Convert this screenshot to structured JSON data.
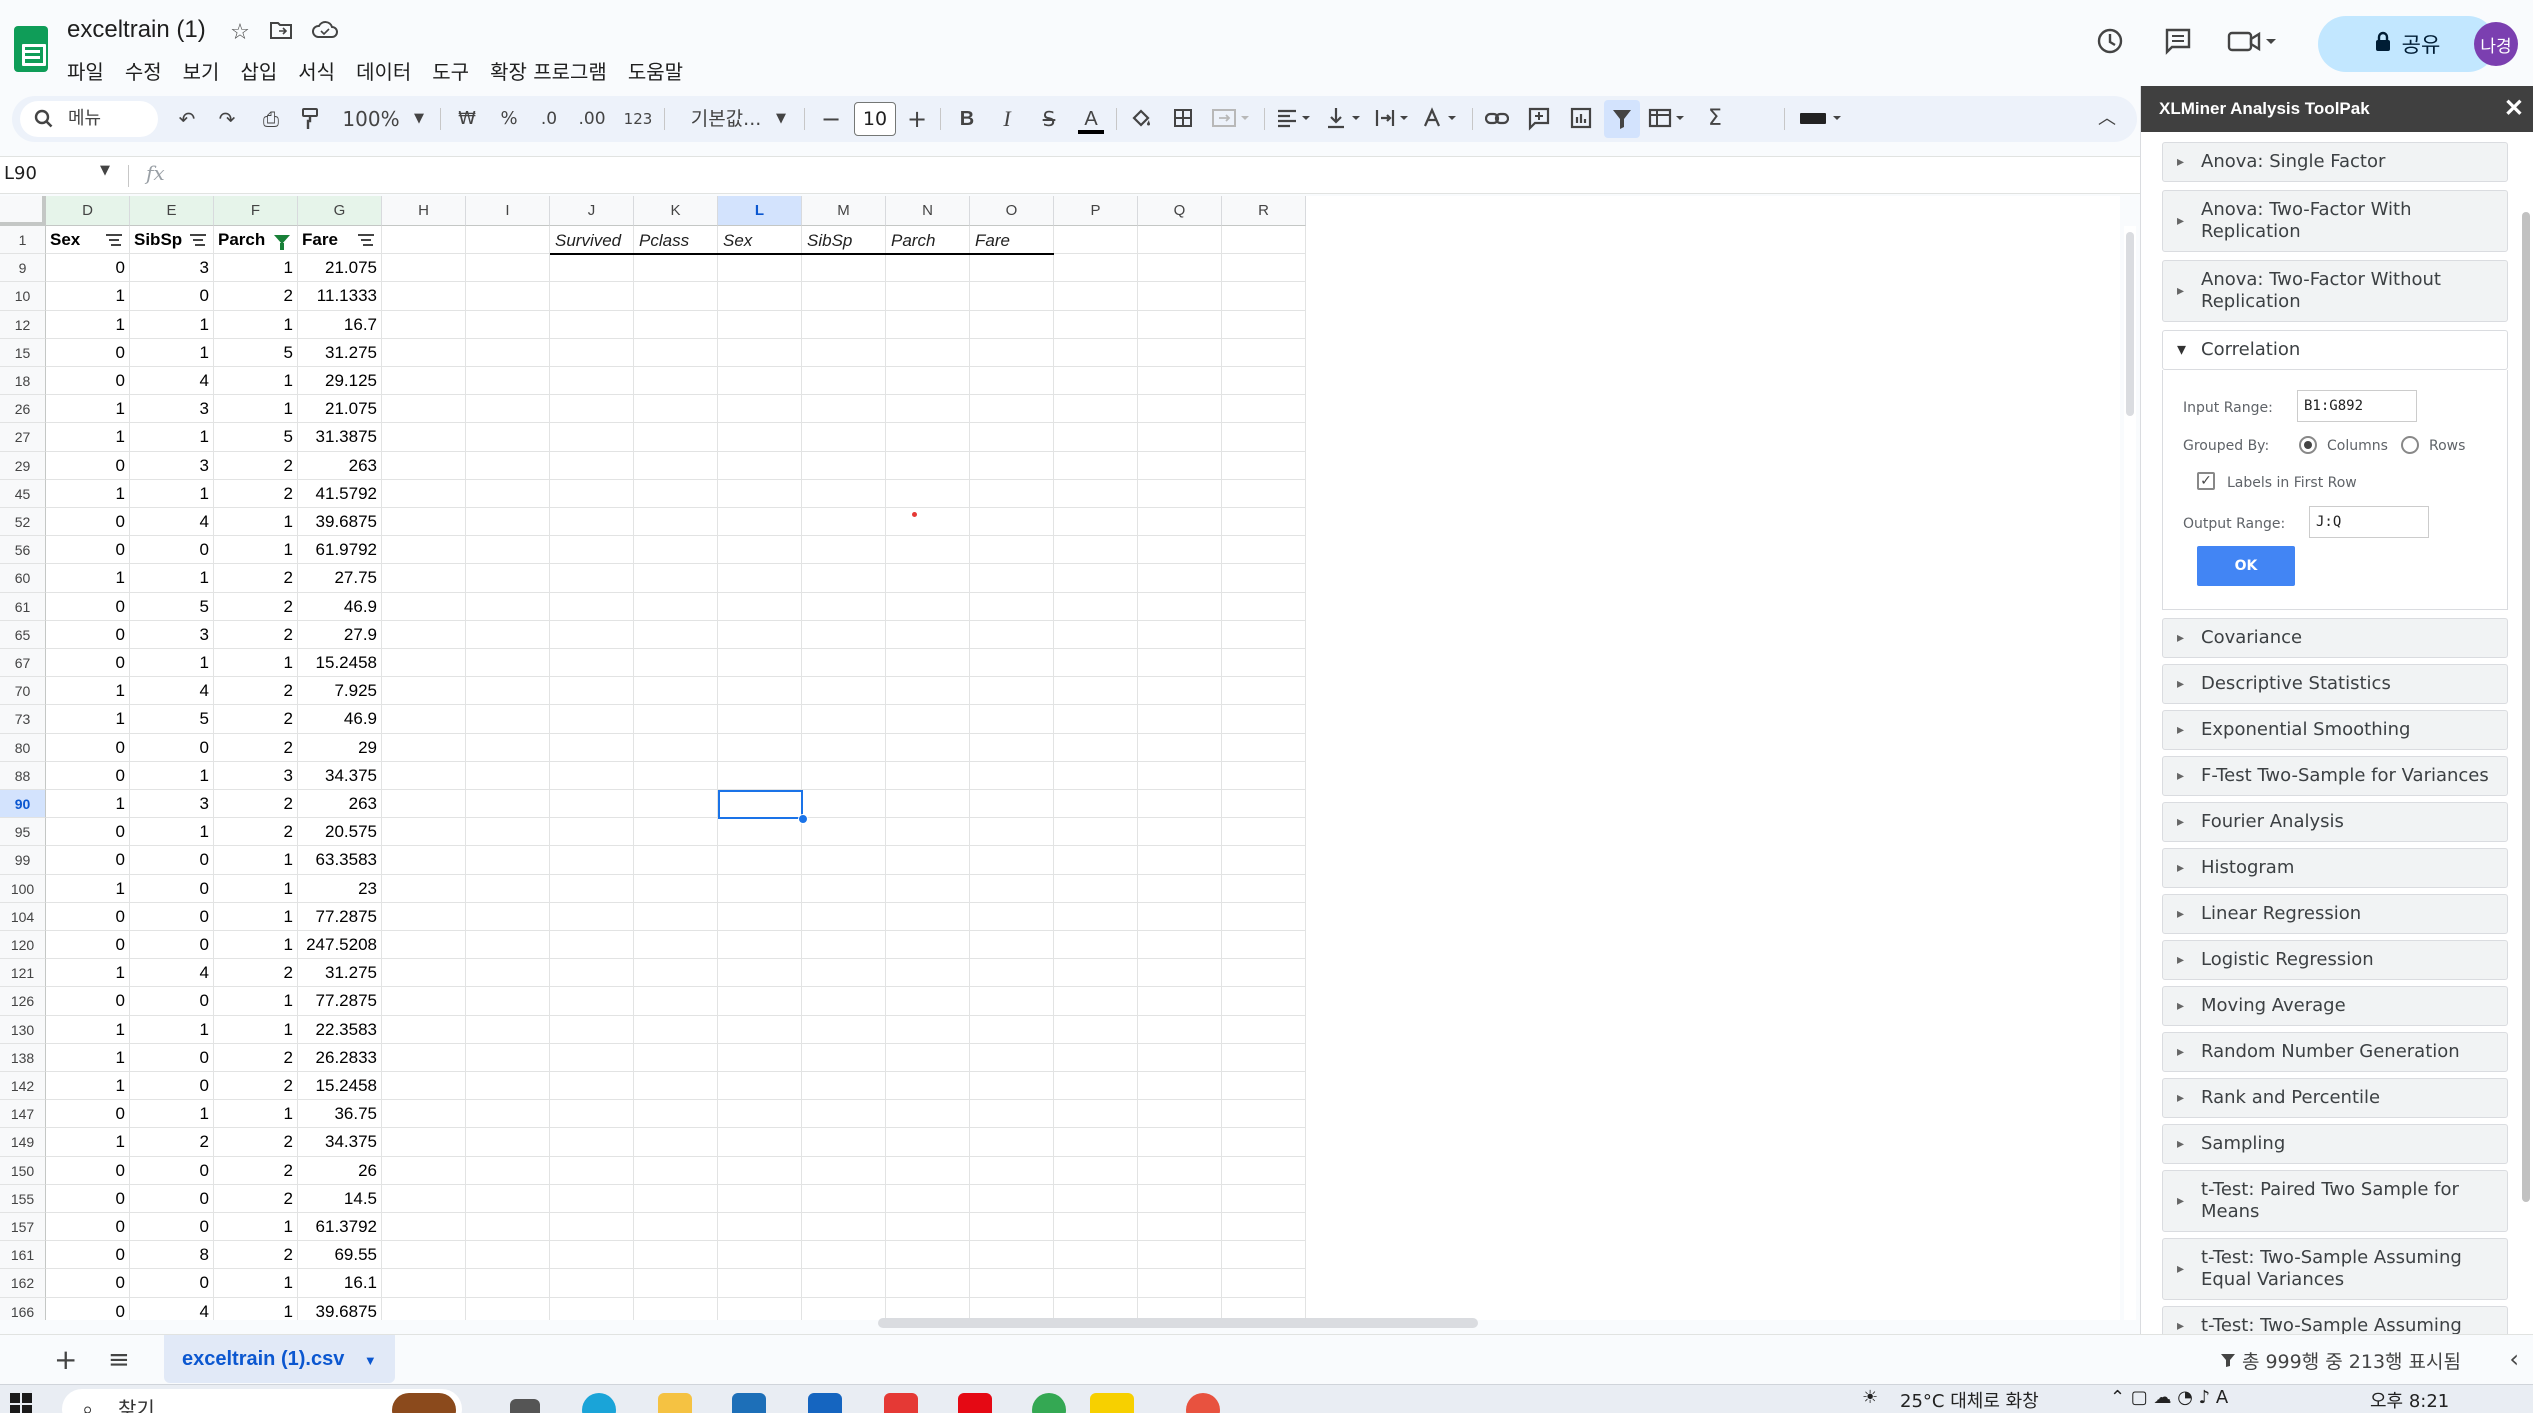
{
  "app": {
    "title": "exceltrain (1)",
    "menu": [
      "파일",
      "수정",
      "보기",
      "삽입",
      "서식",
      "데이터",
      "도구",
      "확장 프로그램",
      "도움말"
    ],
    "share_label": "공유",
    "avatar_initials": "나경"
  },
  "toolbar": {
    "search_label": "메뉴",
    "zoom": "100%",
    "currency": "₩",
    "percent": "%",
    "dec_decrease": ".0",
    "dec_increase": ".00",
    "number_format": "123",
    "font": "기본값...",
    "font_size": "10",
    "bold": "B",
    "italic": "I",
    "strike": "S",
    "text_color": "A"
  },
  "formula_bar": {
    "name_box": "L90",
    "fx": "fx"
  },
  "grid": {
    "columns": [
      "D",
      "E",
      "F",
      "G",
      "H",
      "I",
      "J",
      "K",
      "L",
      "M",
      "N",
      "O",
      "P",
      "Q",
      "R"
    ],
    "header_row_number": "1",
    "data_headers": [
      "Sex",
      "SibSp",
      "Parch",
      "Fare"
    ],
    "output_headers": [
      "Survived",
      "Pclass",
      "Sex",
      "SibSp",
      "Parch",
      "Fare"
    ],
    "rows": [
      {
        "n": "9",
        "v": [
          "0",
          "3",
          "1",
          "21.075"
        ]
      },
      {
        "n": "10",
        "v": [
          "1",
          "0",
          "2",
          "11.1333"
        ]
      },
      {
        "n": "12",
        "v": [
          "1",
          "1",
          "1",
          "16.7"
        ]
      },
      {
        "n": "15",
        "v": [
          "0",
          "1",
          "5",
          "31.275"
        ]
      },
      {
        "n": "18",
        "v": [
          "0",
          "4",
          "1",
          "29.125"
        ]
      },
      {
        "n": "26",
        "v": [
          "1",
          "3",
          "1",
          "21.075"
        ]
      },
      {
        "n": "27",
        "v": [
          "1",
          "1",
          "5",
          "31.3875"
        ]
      },
      {
        "n": "29",
        "v": [
          "0",
          "3",
          "2",
          "263"
        ]
      },
      {
        "n": "45",
        "v": [
          "1",
          "1",
          "2",
          "41.5792"
        ]
      },
      {
        "n": "52",
        "v": [
          "0",
          "4",
          "1",
          "39.6875"
        ]
      },
      {
        "n": "56",
        "v": [
          "0",
          "0",
          "1",
          "61.9792"
        ]
      },
      {
        "n": "60",
        "v": [
          "1",
          "1",
          "2",
          "27.75"
        ]
      },
      {
        "n": "61",
        "v": [
          "0",
          "5",
          "2",
          "46.9"
        ]
      },
      {
        "n": "65",
        "v": [
          "0",
          "3",
          "2",
          "27.9"
        ]
      },
      {
        "n": "67",
        "v": [
          "0",
          "1",
          "1",
          "15.2458"
        ]
      },
      {
        "n": "70",
        "v": [
          "1",
          "4",
          "2",
          "7.925"
        ]
      },
      {
        "n": "73",
        "v": [
          "1",
          "5",
          "2",
          "46.9"
        ]
      },
      {
        "n": "80",
        "v": [
          "0",
          "0",
          "2",
          "29"
        ]
      },
      {
        "n": "88",
        "v": [
          "0",
          "1",
          "3",
          "34.375"
        ]
      },
      {
        "n": "90",
        "v": [
          "1",
          "3",
          "2",
          "263"
        ]
      },
      {
        "n": "95",
        "v": [
          "0",
          "1",
          "2",
          "20.575"
        ]
      },
      {
        "n": "99",
        "v": [
          "0",
          "0",
          "1",
          "63.3583"
        ]
      },
      {
        "n": "100",
        "v": [
          "1",
          "0",
          "1",
          "23"
        ]
      },
      {
        "n": "104",
        "v": [
          "0",
          "0",
          "1",
          "77.2875"
        ]
      },
      {
        "n": "120",
        "v": [
          "0",
          "0",
          "1",
          "247.5208"
        ]
      },
      {
        "n": "121",
        "v": [
          "1",
          "4",
          "2",
          "31.275"
        ]
      },
      {
        "n": "126",
        "v": [
          "0",
          "0",
          "1",
          "77.2875"
        ]
      },
      {
        "n": "130",
        "v": [
          "1",
          "1",
          "1",
          "22.3583"
        ]
      },
      {
        "n": "138",
        "v": [
          "1",
          "0",
          "2",
          "26.2833"
        ]
      },
      {
        "n": "142",
        "v": [
          "1",
          "0",
          "2",
          "15.2458"
        ]
      },
      {
        "n": "147",
        "v": [
          "0",
          "1",
          "1",
          "36.75"
        ]
      },
      {
        "n": "149",
        "v": [
          "1",
          "2",
          "2",
          "34.375"
        ]
      },
      {
        "n": "150",
        "v": [
          "0",
          "0",
          "2",
          "26"
        ]
      },
      {
        "n": "155",
        "v": [
          "0",
          "0",
          "2",
          "14.5"
        ]
      },
      {
        "n": "157",
        "v": [
          "0",
          "0",
          "1",
          "61.3792"
        ]
      },
      {
        "n": "161",
        "v": [
          "0",
          "8",
          "2",
          "69.55"
        ]
      },
      {
        "n": "162",
        "v": [
          "0",
          "0",
          "1",
          "16.1"
        ]
      },
      {
        "n": "166",
        "v": [
          "0",
          "4",
          "1",
          "39.6875"
        ]
      }
    ],
    "selected_row": "90",
    "selected_column": "L"
  },
  "sheet_tabs": {
    "active": "exceltrain (1).csv",
    "status": "총 999행 중 213행 표시됨"
  },
  "panel": {
    "title": "XLMiner Analysis ToolPak",
    "items_before": [
      "Anova: Single Factor",
      "Anova: Two-Factor With Replication",
      "Anova: Two-Factor Without Replication"
    ],
    "open_item": "Correlation",
    "form": {
      "input_range_label": "Input Range:",
      "input_range_value": "B1:G892",
      "grouped_by_label": "Grouped By:",
      "columns_label": "Columns",
      "rows_label": "Rows",
      "labels_first_row": "Labels in First Row",
      "output_range_label": "Output Range:",
      "output_range_value": "J:Q",
      "ok_label": "OK"
    },
    "items_after": [
      "Covariance",
      "Descriptive Statistics",
      "Exponential Smoothing",
      "F-Test Two-Sample for Variances",
      "Fourier Analysis",
      "Histogram",
      "Linear Regression",
      "Logistic Regression",
      "Moving Average",
      "Random Number Generation",
      "Rank and Percentile",
      "Sampling",
      "t-Test: Paired Two Sample for Means",
      "t-Test: Two-Sample Assuming Equal Variances",
      "t-Test: Two-Sample Assuming"
    ]
  },
  "taskbar": {
    "search_placeholder": "찾기",
    "weather": "25°C 대체로 화창",
    "time": "오후 8:21"
  }
}
